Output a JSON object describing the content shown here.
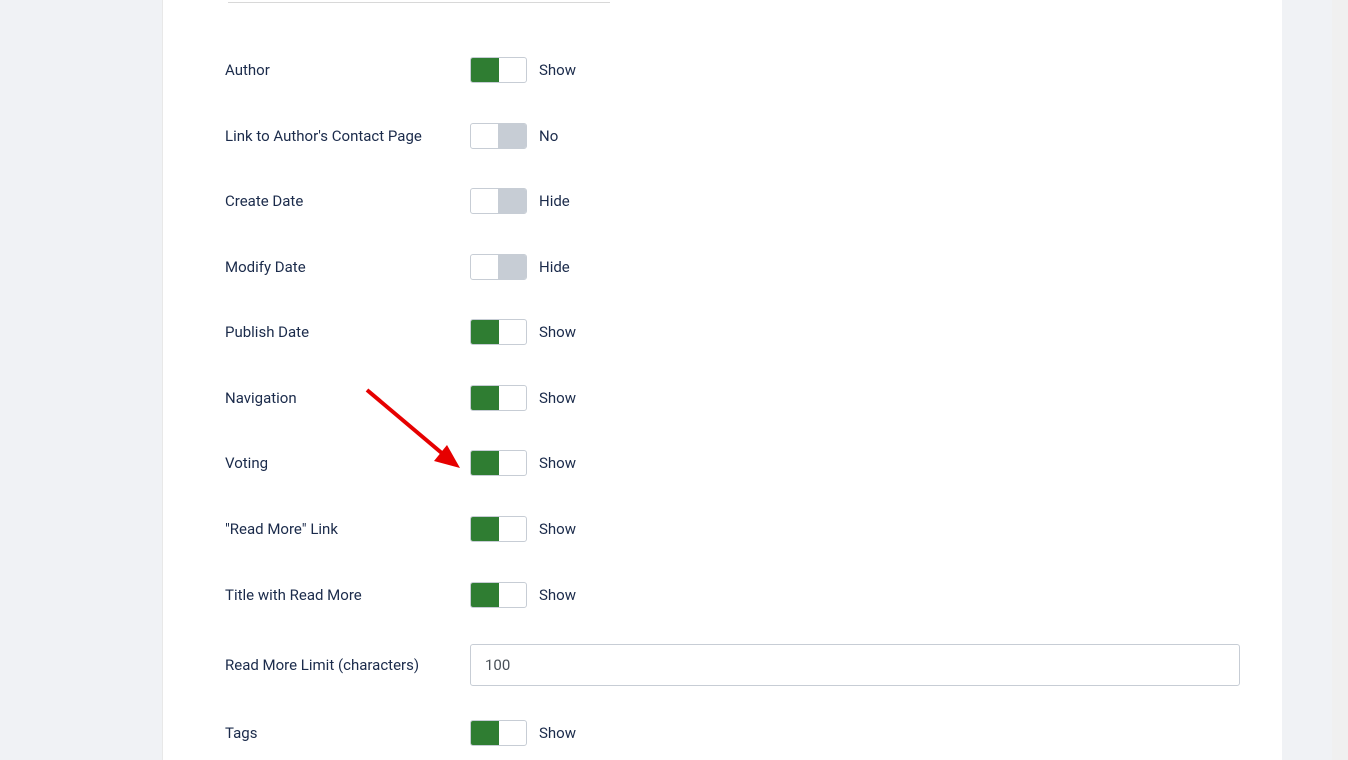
{
  "settings": {
    "author": {
      "label": "Author",
      "on": true,
      "status": "Show"
    },
    "link_author_contact": {
      "label": "Link to Author's Contact Page",
      "on": false,
      "status": "No"
    },
    "create_date": {
      "label": "Create Date",
      "on": false,
      "status": "Hide"
    },
    "modify_date": {
      "label": "Modify Date",
      "on": false,
      "status": "Hide"
    },
    "publish_date": {
      "label": "Publish Date",
      "on": true,
      "status": "Show"
    },
    "navigation": {
      "label": "Navigation",
      "on": true,
      "status": "Show"
    },
    "voting": {
      "label": "Voting",
      "on": true,
      "status": "Show"
    },
    "read_more_link": {
      "label": "\"Read More\" Link",
      "on": true,
      "status": "Show"
    },
    "title_with_read_more": {
      "label": "Title with Read More",
      "on": true,
      "status": "Show"
    },
    "read_more_limit": {
      "label": "Read More Limit (characters)",
      "value": "100"
    },
    "tags": {
      "label": "Tags",
      "on": true,
      "status": "Show"
    }
  }
}
